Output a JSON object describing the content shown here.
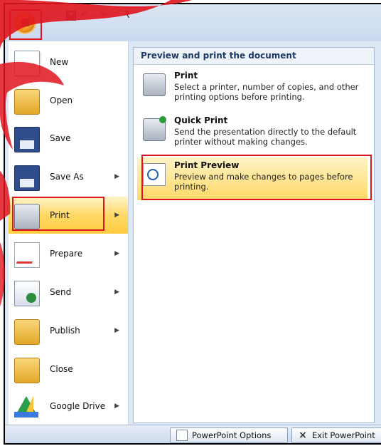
{
  "menu": {
    "items": [
      {
        "name": "new",
        "label": "New",
        "arrow": false
      },
      {
        "name": "open",
        "label": "Open",
        "arrow": false
      },
      {
        "name": "save",
        "label": "Save",
        "arrow": false
      },
      {
        "name": "save-as",
        "label": "Save As",
        "arrow": true
      },
      {
        "name": "print",
        "label": "Print",
        "arrow": true
      },
      {
        "name": "prepare",
        "label": "Prepare",
        "arrow": true
      },
      {
        "name": "send",
        "label": "Send",
        "arrow": true
      },
      {
        "name": "publish",
        "label": "Publish",
        "arrow": true
      },
      {
        "name": "close",
        "label": "Close",
        "arrow": false
      },
      {
        "name": "google-drive",
        "label": "Google Drive",
        "arrow": true
      }
    ],
    "arrow_glyph": "▶"
  },
  "submenu": {
    "header": "Preview and print the document",
    "options": [
      {
        "title": "Print",
        "description": "Select a printer, number of copies, and other printing options before printing."
      },
      {
        "title": "Quick Print",
        "description": "Send the presentation directly to the default printer without making changes."
      },
      {
        "title": "Print Preview",
        "description": "Preview and make changes to pages before printing."
      }
    ]
  },
  "bottom": {
    "options_label": "PowerPoint Options",
    "exit_label": "Exit PowerPoint"
  },
  "qat": {
    "undo_glyph": "↶ -",
    "redo_glyph": "↷",
    "customize_glyph": "₹"
  },
  "colors": {
    "highlight_border": "#e0141e",
    "active_gradient_top": "#fff5cc",
    "active_gradient_bottom": "#ffcc40"
  }
}
